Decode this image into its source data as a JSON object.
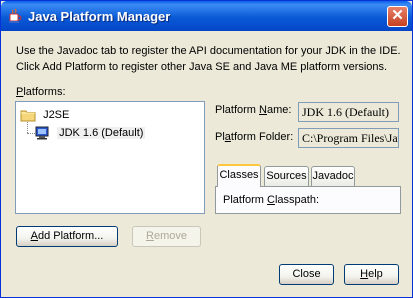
{
  "window": {
    "title": "Java Platform Manager",
    "close_label": "✕"
  },
  "intro": {
    "line1": "Use the Javadoc tab to register the API documentation for your JDK in the IDE.",
    "line2": "Click Add Platform to register other Java SE and Java ME platform versions."
  },
  "platforms": {
    "label_underlined": "P",
    "label_rest": "latforms:",
    "tree": {
      "node_label": "J2SE",
      "leaf_label": "JDK 1.6 (Default)"
    }
  },
  "details": {
    "name_label_pre": "Platform ",
    "name_label_ul": "N",
    "name_label_post": "ame:",
    "name_value": "JDK 1.6 (Default)",
    "folder_label_pre": "Pl",
    "folder_label_ul": "a",
    "folder_label_post": "tform Folder:",
    "folder_value": "C:\\Program Files\\Jav"
  },
  "tabs": [
    "Classes",
    "Sources",
    "Javadoc"
  ],
  "classpath": {
    "label_pre": "Platform ",
    "label_ul": "C",
    "label_post": "lasspath:"
  },
  "buttons": {
    "add_platform_ul": "A",
    "add_platform_rest": "dd Platform...",
    "remove_ul": "R",
    "remove_rest": "emove",
    "close": "Close",
    "help_ul": "H",
    "help_rest": "elp"
  },
  "colors": {
    "titlebar": "#0a5ad6",
    "dialog_bg": "#ece9d8",
    "close_button": "#c5401f",
    "active_tab_accent": "#ffc83c"
  }
}
